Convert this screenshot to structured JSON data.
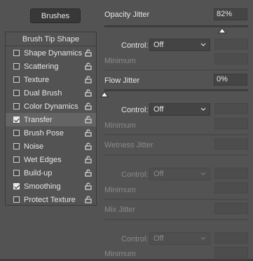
{
  "left": {
    "brushes_button": "Brushes",
    "tip_shape": "Brush Tip Shape",
    "items": [
      {
        "label": "Shape Dynamics",
        "checked": false,
        "selected": false,
        "lock": true
      },
      {
        "label": "Scattering",
        "checked": false,
        "selected": false,
        "lock": true
      },
      {
        "label": "Texture",
        "checked": false,
        "selected": false,
        "lock": true
      },
      {
        "label": "Dual Brush",
        "checked": false,
        "selected": false,
        "lock": true
      },
      {
        "label": "Color Dynamics",
        "checked": false,
        "selected": false,
        "lock": true
      },
      {
        "label": "Transfer",
        "checked": true,
        "selected": true,
        "lock": true
      },
      {
        "label": "Brush Pose",
        "checked": false,
        "selected": false,
        "lock": true
      },
      {
        "label": "Noise",
        "checked": false,
        "selected": false,
        "lock": true
      },
      {
        "label": "Wet Edges",
        "checked": false,
        "selected": false,
        "lock": true
      },
      {
        "label": "Build-up",
        "checked": false,
        "selected": false,
        "lock": true
      },
      {
        "label": "Smoothing",
        "checked": true,
        "selected": false,
        "lock": true
      },
      {
        "label": "Protect Texture",
        "checked": false,
        "selected": false,
        "lock": true
      }
    ]
  },
  "transfer": {
    "opacity_jitter": {
      "label": "Opacity Jitter",
      "value": "82%",
      "slider_fraction": 0.82,
      "control_label": "Control:",
      "control_value": "Off",
      "minimum_label": "Minimum"
    },
    "flow_jitter": {
      "label": "Flow Jitter",
      "value": "0%",
      "slider_fraction": 0.0,
      "control_label": "Control:",
      "control_value": "Off",
      "minimum_label": "Minimum"
    },
    "wetness_jitter": {
      "label": "Wetness Jitter",
      "control_label": "Control:",
      "control_value": "Off",
      "minimum_label": "Minimum"
    },
    "mix_jitter": {
      "label": "Mix Jitter",
      "control_label": "Control:",
      "control_value": "Off",
      "minimum_label": "Minimum"
    }
  },
  "colors": {
    "background": "#535353",
    "selected_row": "#646464",
    "dim_text": "#8a8a8a"
  }
}
